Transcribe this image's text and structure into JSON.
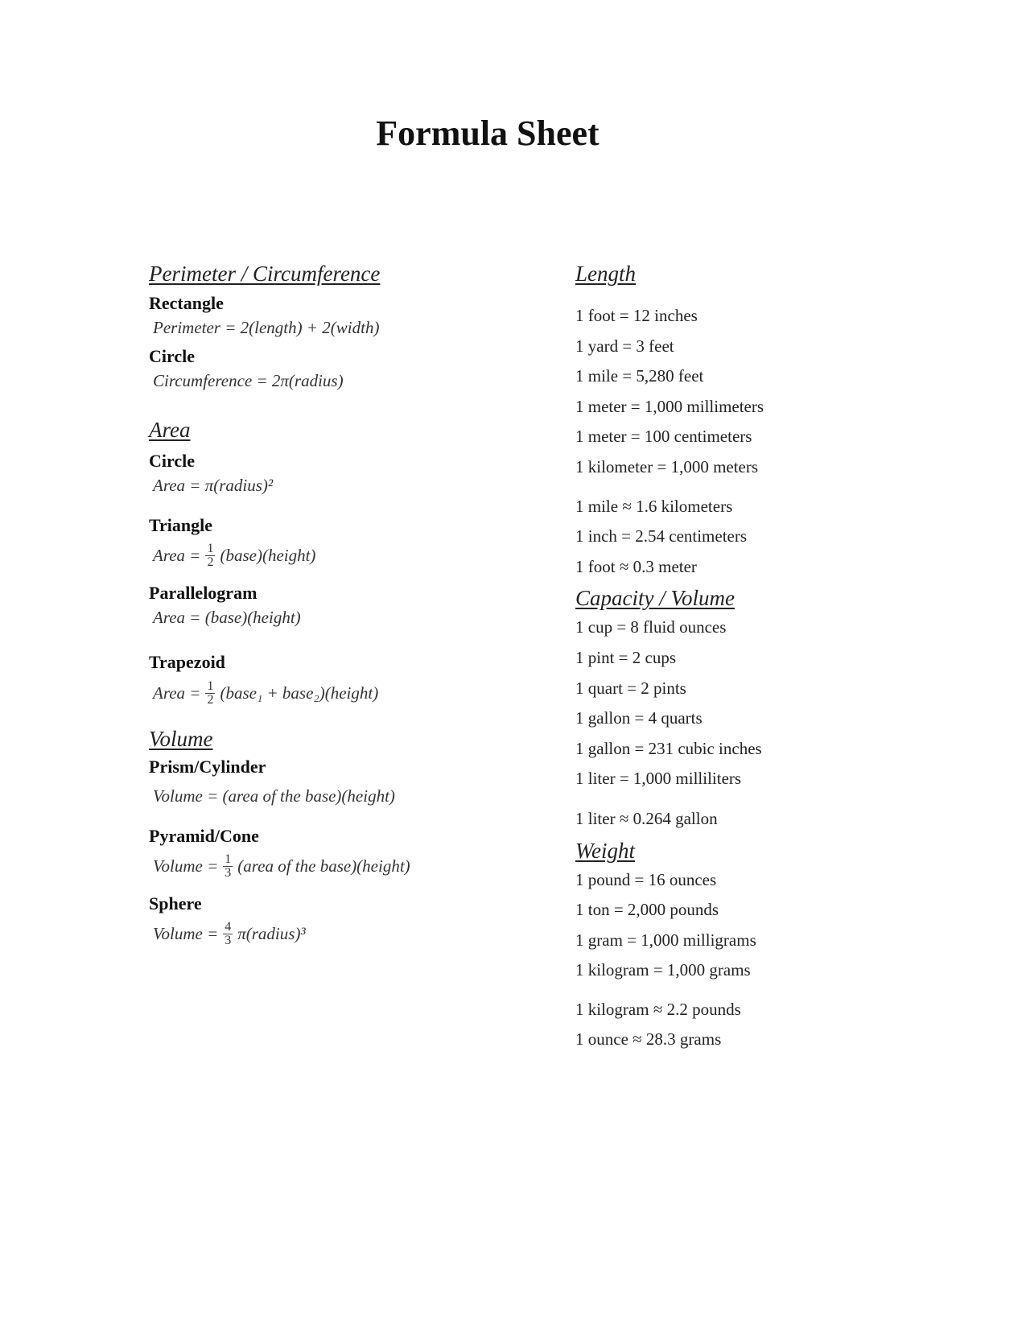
{
  "title": "Formula Sheet",
  "left": {
    "perimeter": {
      "heading": "Perimeter / Circumference",
      "items": [
        {
          "name": "Rectangle",
          "formula": "Perimeter = 2(length) + 2(width)"
        },
        {
          "name": "Circle",
          "formula": "Circumference = 2π(radius)"
        }
      ]
    },
    "area": {
      "heading": "Area",
      "items": [
        {
          "name": "Circle",
          "formula": "Area = π(radius)²"
        },
        {
          "name": "Triangle",
          "lhs": "Area =",
          "frac": {
            "num": "1",
            "den": "2"
          },
          "rhs": "(base)(height)"
        },
        {
          "name": "Parallelogram",
          "formula": "Area = (base)(height)"
        },
        {
          "name": "Trapezoid",
          "lhs": "Area =",
          "frac": {
            "num": "1",
            "den": "2"
          },
          "rhs": "(base₁ + base₂)(height)"
        }
      ]
    },
    "volume": {
      "heading": "Volume",
      "items": [
        {
          "name": "Prism/Cylinder",
          "formula": "Volume = (area of the base)(height)"
        },
        {
          "name": "Pyramid/Cone",
          "lhs": "Volume =",
          "frac": {
            "num": "1",
            "den": "3"
          },
          "rhs": "(area of the base)(height)"
        },
        {
          "name": "Sphere",
          "lhs": "Volume =",
          "frac": {
            "num": "4",
            "den": "3"
          },
          "rhs": "π(radius)³"
        }
      ]
    }
  },
  "right": {
    "length": {
      "heading": "Length",
      "items": [
        "1 foot = 12 inches",
        "1 yard = 3 feet",
        "1 mile = 5,280 feet",
        "1 meter = 1,000 millimeters",
        "1 meter = 100 centimeters",
        "1 kilometer = 1,000 meters",
        "1 mile ≈ 1.6 kilometers",
        "1 inch = 2.54 centimeters",
        "1 foot ≈ 0.3 meter"
      ]
    },
    "capacity": {
      "heading": "Capacity / Volume",
      "items": [
        "1 cup = 8 fluid ounces",
        "1 pint = 2 cups",
        "1 quart = 2 pints",
        "1 gallon = 4 quarts",
        "1 gallon = 231 cubic inches",
        "1 liter = 1,000 milliliters",
        "1 liter ≈ 0.264 gallon"
      ]
    },
    "weight": {
      "heading": "Weight",
      "items": [
        "1 pound = 16 ounces",
        "1 ton = 2,000 pounds",
        "1 gram = 1,000 milligrams",
        "1 kilogram = 1,000 grams",
        "1 kilogram ≈ 2.2 pounds",
        "1 ounce ≈ 28.3 grams"
      ]
    }
  }
}
